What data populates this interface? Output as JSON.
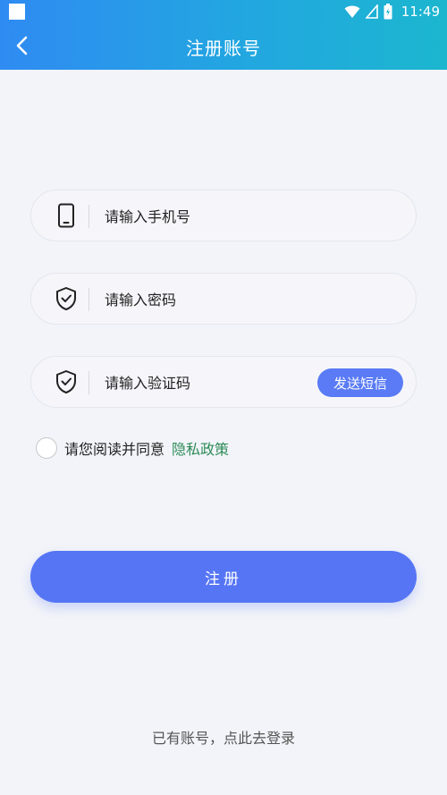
{
  "status_bar": {
    "time": "11:49",
    "icons": [
      "app-notification-icon",
      "wifi-icon",
      "signal-icon",
      "battery-icon"
    ]
  },
  "header": {
    "title": "注册账号",
    "back_icon": "chevron-left-icon"
  },
  "form": {
    "phone": {
      "placeholder": "请输入手机号",
      "icon": "phone-icon"
    },
    "password": {
      "placeholder": "请输入密码",
      "icon": "shield-check-icon"
    },
    "code": {
      "placeholder": "请输入验证码",
      "icon": "shield-check-icon",
      "send_label": "发送短信"
    }
  },
  "agreement": {
    "text": "请您阅读并同意",
    "link": "隐私政策",
    "checked": false
  },
  "register_label": "注册",
  "login_prompt": "已有账号，点此去登录",
  "colors": {
    "header_start": "#2f8bf2",
    "header_end": "#1cb6cf",
    "primary": "#5675f5",
    "link_green": "#2e8b57",
    "background": "#f2f4f9"
  }
}
